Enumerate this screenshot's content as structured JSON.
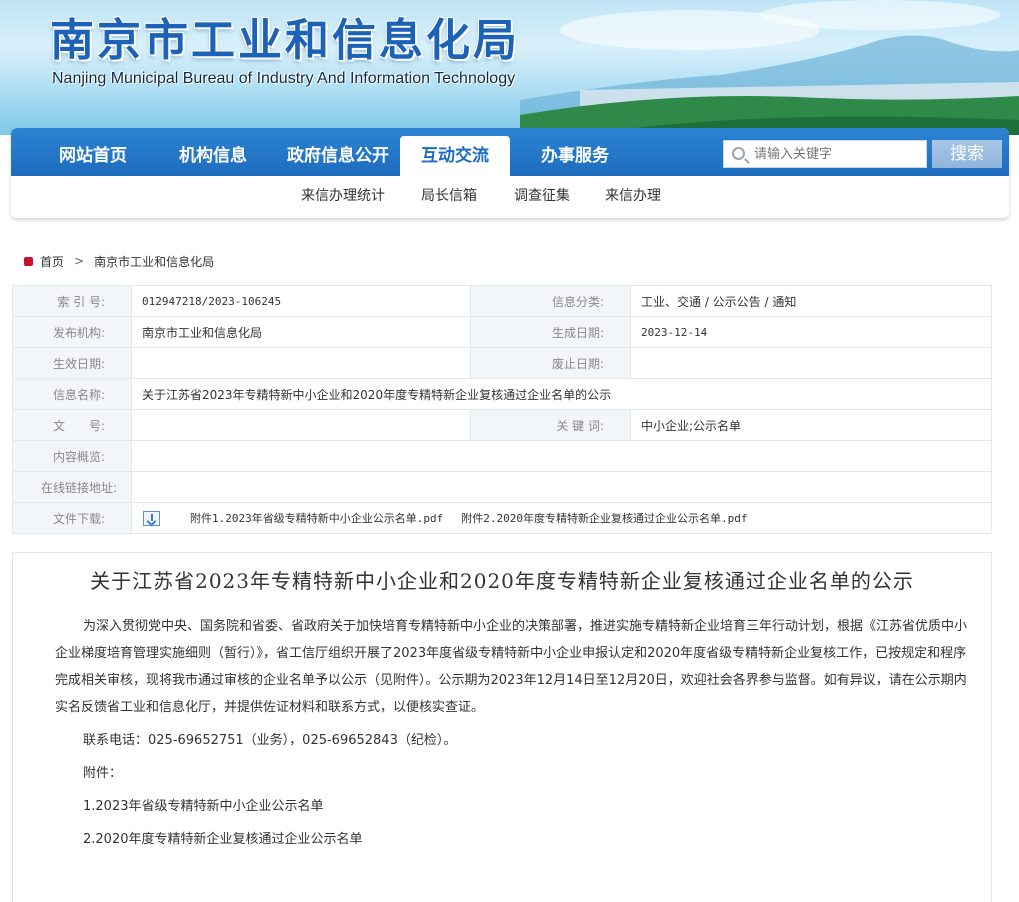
{
  "banner": {
    "title_cn": "南京市工业和信息化局",
    "title_en": "Nanjing Municipal Bureau of Industry And Information Technology"
  },
  "nav": {
    "items": [
      {
        "label": "网站首页",
        "active": false
      },
      {
        "label": "机构信息",
        "active": false
      },
      {
        "label": "政府信息公开",
        "active": false
      },
      {
        "label": "互动交流",
        "active": true
      },
      {
        "label": "办事服务",
        "active": false
      }
    ],
    "search_placeholder": "请输入关键字",
    "search_button": "搜索",
    "sub_items": [
      "来信办理统计",
      "局长信箱",
      "调查征集",
      "来信办理"
    ]
  },
  "breadcrumb": {
    "home": "首页",
    "separator": ">",
    "current": "南京市工业和信息化局"
  },
  "info": {
    "index_label": "索 引 号:",
    "index_value": "012947218/2023-106245",
    "category_label": "信息分类:",
    "category_value": "工业、交通 / 公示公告 / 通知",
    "publisher_label": "发布机构:",
    "publisher_value": "南京市工业和信息化局",
    "created_label": "生成日期:",
    "created_value": "2023-12-14",
    "effective_label": "生效日期:",
    "effective_value": "",
    "expire_label": "废止日期:",
    "expire_value": "",
    "name_label": "信息名称:",
    "name_value": "关于江苏省2023年专精特新中小企业和2020年度专精特新企业复核通过企业名单的公示",
    "docno_label": "文　　号:",
    "docno_value": "",
    "keywords_label": "关 键 词:",
    "keywords_value": "中小企业;公示名单",
    "summary_label": "内容概览:",
    "summary_value": "",
    "online_label": "在线链接地址:",
    "online_value": "",
    "download_label": "文件下载:",
    "attachments": [
      "附件1.2023年省级专精特新中小企业公示名单.pdf",
      "附件2.2020年度专精特新企业复核通过企业公示名单.pdf"
    ]
  },
  "article": {
    "title": "关于江苏省2023年专精特新中小企业和2020年度专精特新企业复核通过企业名单的公示",
    "paragraph1": "为深入贯彻党中央、国务院和省委、省政府关于加快培育专精特新中小企业的决策部署，推进实施专精特新企业培育三年行动计划，根据《江苏省优质中小企业梯度培育管理实施细则（暂行）》，省工信厅组织开展了2023年度省级专精特新中小企业申报认定和2020年度省级专精特新企业复核工作，已按规定和程序完成相关审核，现将我市通过审核的企业名单予以公示（见附件）。公示期为2023年12月14日至12月20日，欢迎社会各界参与监督。如有异议，请在公示期内实名反馈省工业和信息化厅，并提供佐证材料和联系方式，以便核实查证。",
    "contact": "联系电话：025-69652751（业务），025-69652843（纪检）。",
    "attach_heading": "附件：",
    "attach1": "1.2023年省级专精特新中小企业公示名单",
    "attach2": "2.2020年度专精特新企业复核通过企业公示名单"
  },
  "colors": {
    "nav_blue": "#1e6cbd",
    "title_blue": "#1c63b8",
    "home_red": "#c8102e"
  }
}
